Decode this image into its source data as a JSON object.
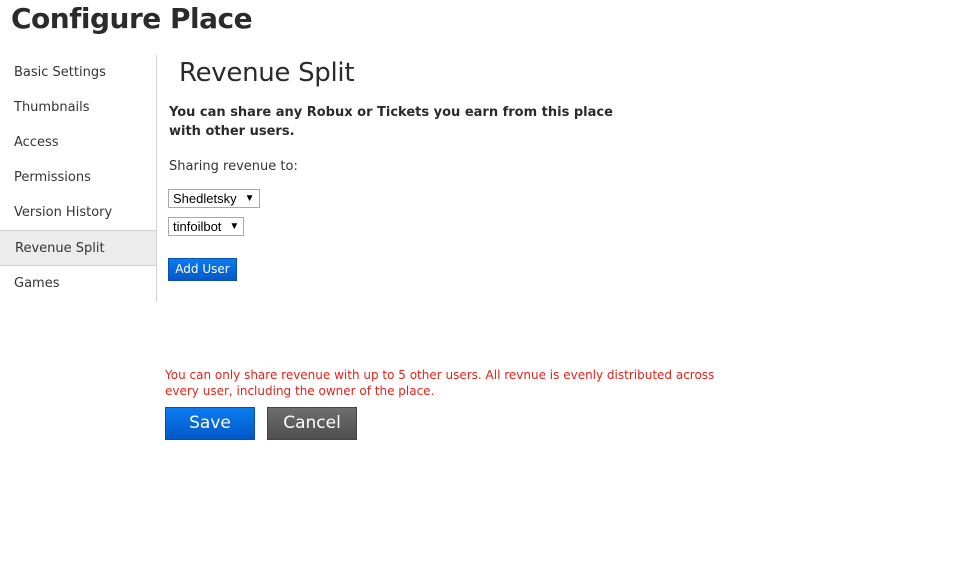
{
  "page": {
    "title": "Configure Place"
  },
  "sidebar": {
    "items": [
      {
        "label": "Basic Settings",
        "active": false
      },
      {
        "label": "Thumbnails",
        "active": false
      },
      {
        "label": "Access",
        "active": false
      },
      {
        "label": "Permissions",
        "active": false
      },
      {
        "label": "Version History",
        "active": false
      },
      {
        "label": "Revenue Split",
        "active": true
      },
      {
        "label": "Games",
        "active": false
      }
    ]
  },
  "main": {
    "section_title": "Revenue Split",
    "intro": "You can share any Robux or Tickets you earn from this place with other users.",
    "sharing_label": "Sharing revenue to:",
    "users": [
      {
        "selected": "Shedletsky"
      },
      {
        "selected": "tinfoilbot"
      }
    ],
    "caret_glyph": "▼",
    "add_user_label": "Add User",
    "limit_note": "You can only share revenue with up to 5 other users. All revnue is evenly distributed across every user, including the owner of the place.",
    "save_label": "Save",
    "cancel_label": "Cancel"
  },
  "colors": {
    "primary_button": "#0466d9",
    "secondary_button": "#5e5e5e",
    "warning_text": "#e2231a",
    "active_nav_bg": "#ececec"
  }
}
